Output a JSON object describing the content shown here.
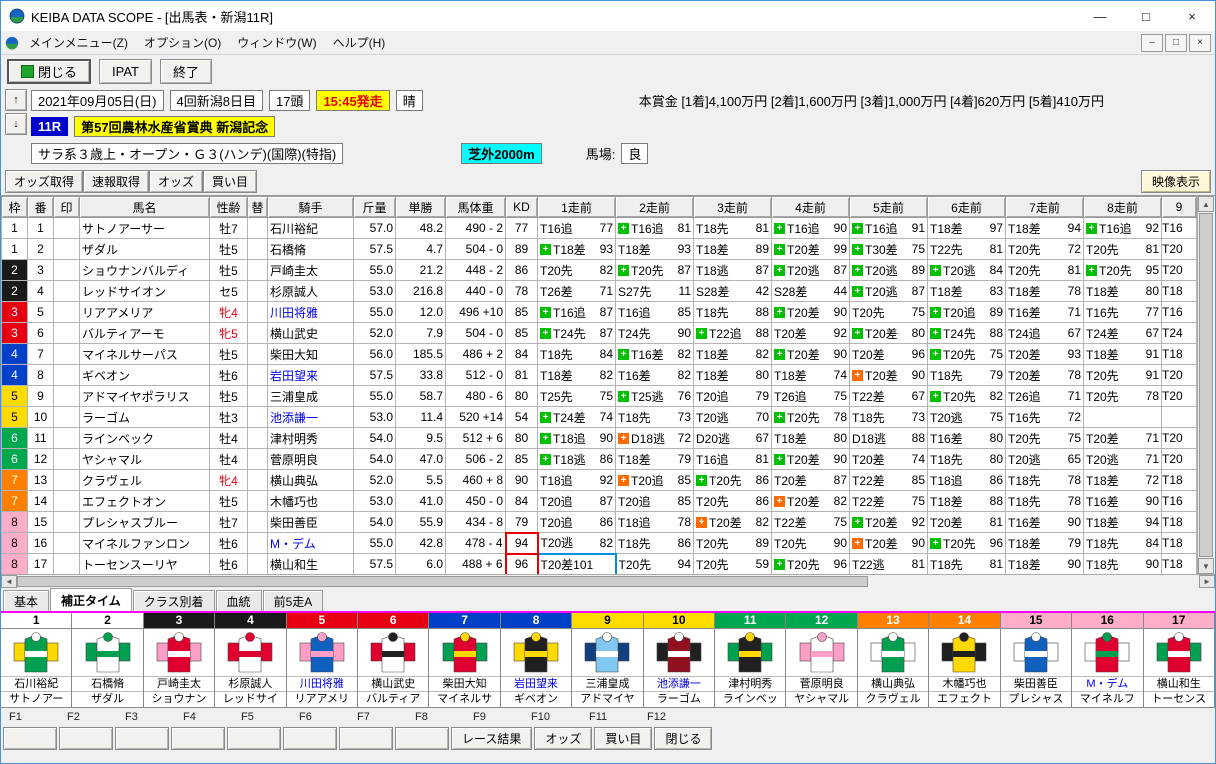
{
  "window": {
    "title": "KEIBA DATA SCOPE - [出馬表・新潟11R]",
    "menu": [
      "メインメニュー(Z)",
      "オプション(O)",
      "ウィンドウ(W)",
      "ヘルプ(H)"
    ]
  },
  "icons": {
    "up": "↑",
    "down": "↓",
    "left": "◄",
    "right": "►",
    "sb_up": "▲",
    "sb_down": "▼",
    "minimize": "—",
    "maximize": "□",
    "close": "×",
    "mdi_minimize": "–",
    "mdi_restore": "□",
    "mdi_close": "×"
  },
  "toolbar": {
    "close": "閉じる",
    "ipat": "IPAT",
    "exit": "終了"
  },
  "race": {
    "date": "2021年09月05日(日)",
    "meeting": "4回新潟8日目",
    "heads": "17頭",
    "start": "15:45発走",
    "weather": "晴",
    "prize": "本賞金 [1着]4,100万円 [2着]1,600万円 [3着]1,000万円 [4着]620万円 [5着]410万円",
    "race_no": "11R",
    "race_name": "第57回農林水産省賞典 新潟記念",
    "conditions": "サラ系３歳上・オープン・Ｇ３(ハンデ)(国際)(特指)",
    "course": "芝外2000m",
    "track_label": "馬場:",
    "track_cond": "良"
  },
  "toolbar2": {
    "buttons": [
      "オッズ取得",
      "速報取得",
      "オッズ",
      "買い目"
    ],
    "right": "映像表示"
  },
  "table": {
    "headers": [
      "枠",
      "番",
      "印",
      "馬名",
      "性齢",
      "替",
      "騎手",
      "斤量",
      "単勝",
      "馬体重",
      "KD",
      "1走前",
      "2走前",
      "3走前",
      "4走前",
      "5走前",
      "6走前",
      "7走前",
      "8走前",
      "9"
    ],
    "rows": [
      {
        "waku": "1",
        "num": "1",
        "mark": "",
        "name": "サトノアーサー",
        "sex": "牡7",
        "sexRed": false,
        "kae": "",
        "jockey": "石川裕紀",
        "jBlue": false,
        "kin": "57.0",
        "odds": "48.2",
        "body": "490 - 2",
        "kd": "77",
        "kdBox": false,
        "races": [
          [
            "",
            "T16追 77"
          ],
          [
            "g",
            "T16追 81"
          ],
          [
            "",
            "T18先 81"
          ],
          [
            "g",
            "T16追 90"
          ],
          [
            "g",
            "T16追 91"
          ],
          [
            "",
            "T18差 97"
          ],
          [
            "",
            "T18差 94"
          ],
          [
            "g",
            "T16追 92"
          ]
        ],
        "cut": "T16"
      },
      {
        "waku": "1",
        "num": "2",
        "mark": "",
        "name": "ザダル",
        "sex": "牡5",
        "kae": "",
        "jockey": "石橋脩",
        "kin": "57.5",
        "odds": "4.7",
        "body": "504 - 0",
        "kd": "89",
        "races": [
          [
            "g",
            "T18差 93"
          ],
          [
            "",
            "T18差 93"
          ],
          [
            "",
            "T18差 89"
          ],
          [
            "g",
            "T20差 99"
          ],
          [
            "g",
            "T30差 75"
          ],
          [
            "",
            "T22先 81"
          ],
          [
            "",
            "T20先 72"
          ],
          [
            "",
            "T20先 81"
          ]
        ],
        "cut": "T20"
      },
      {
        "waku": "2",
        "num": "3",
        "mark": "",
        "name": "ショウナンバルディ",
        "sex": "牡5",
        "kae": "",
        "jockey": "戸崎圭太",
        "kin": "55.0",
        "odds": "21.2",
        "body": "448 - 2",
        "kd": "86",
        "races": [
          [
            "",
            "T20先 82"
          ],
          [
            "g",
            "T20先 87"
          ],
          [
            "",
            "T18逃 87"
          ],
          [
            "g",
            "T20逃 87"
          ],
          [
            "g",
            "T20逃 89"
          ],
          [
            "g",
            "T20逃 84"
          ],
          [
            "",
            "T20先 81"
          ],
          [
            "g",
            "T20先 95"
          ]
        ],
        "cut": "T20"
      },
      {
        "waku": "2",
        "num": "4",
        "mark": "",
        "name": "レッドサイオン",
        "sex": "セ5",
        "kae": "",
        "jockey": "杉原誠人",
        "kin": "53.0",
        "odds": "216.8",
        "body": "440 - 0",
        "kd": "78",
        "races": [
          [
            "",
            "T26差 71"
          ],
          [
            "",
            "S27先 11"
          ],
          [
            "",
            "S28差 42"
          ],
          [
            "",
            "S28差 44"
          ],
          [
            "g",
            "T20逃 87"
          ],
          [
            "",
            "T18差 83"
          ],
          [
            "",
            "T18差 78"
          ],
          [
            "",
            "T18差 80"
          ]
        ],
        "cut": "T18"
      },
      {
        "waku": "3",
        "num": "5",
        "mark": "",
        "name": "リアアメリア",
        "sex": "牝4",
        "sexRed": true,
        "kae": "",
        "jockey": "川田将雅",
        "jBlue": true,
        "kin": "55.0",
        "odds": "12.0",
        "body": "496 +10",
        "kd": "85",
        "races": [
          [
            "g",
            "T16追 87"
          ],
          [
            "",
            "T16追 85"
          ],
          [
            "",
            "T18先 88"
          ],
          [
            "g",
            "T20差 90"
          ],
          [
            "",
            "T20先 75"
          ],
          [
            "g",
            "T20追 89"
          ],
          [
            "",
            "T16差 71"
          ],
          [
            "",
            "T16先 77"
          ]
        ],
        "cut": "T16"
      },
      {
        "waku": "3",
        "num": "6",
        "mark": "",
        "name": "バルティアーモ",
        "sex": "牝5",
        "sexRed": true,
        "kae": "",
        "jockey": "横山武史",
        "kin": "52.0",
        "odds": "7.9",
        "body": "504 - 0",
        "kd": "85",
        "races": [
          [
            "g",
            "T24先 87"
          ],
          [
            "",
            "T24先 90"
          ],
          [
            "g",
            "T22追 88"
          ],
          [
            "",
            "T20差 92"
          ],
          [
            "g",
            "T20差 80"
          ],
          [
            "g",
            "T24先 88"
          ],
          [
            "",
            "T24追 67"
          ],
          [
            "",
            "T24差 67"
          ]
        ],
        "cut": "T24"
      },
      {
        "waku": "4",
        "num": "7",
        "mark": "",
        "name": "マイネルサーパス",
        "sex": "牡5",
        "kae": "",
        "jockey": "柴田大知",
        "kin": "56.0",
        "odds": "185.5",
        "body": "486 + 2",
        "kd": "84",
        "races": [
          [
            "",
            "T18先 84"
          ],
          [
            "g",
            "T16差 82"
          ],
          [
            "",
            "T18差 82"
          ],
          [
            "g",
            "T20差 90"
          ],
          [
            "",
            "T20差 96"
          ],
          [
            "g",
            "T20先 75"
          ],
          [
            "",
            "T20差 93"
          ],
          [
            "",
            "T18差 91"
          ]
        ],
        "cut": "T18"
      },
      {
        "waku": "4",
        "num": "8",
        "mark": "",
        "name": "ギベオン",
        "sex": "牡6",
        "kae": "",
        "jockey": "岩田望来",
        "jBlue": true,
        "kin": "57.5",
        "odds": "33.8",
        "body": "512 - 0",
        "kd": "81",
        "races": [
          [
            "",
            "T18差 82"
          ],
          [
            "",
            "T16差 82"
          ],
          [
            "",
            "T18差 80"
          ],
          [
            "",
            "T18差 74"
          ],
          [
            "o",
            "T20差 90"
          ],
          [
            "",
            "T18先 79"
          ],
          [
            "",
            "T20差 78"
          ],
          [
            "",
            "T20先 91"
          ]
        ],
        "cut": "T20"
      },
      {
        "waku": "5",
        "num": "9",
        "mark": "",
        "name": "アドマイヤポラリス",
        "sex": "牡5",
        "kae": "",
        "jockey": "三浦皇成",
        "kin": "55.0",
        "odds": "58.7",
        "body": "480 - 6",
        "kd": "80",
        "races": [
          [
            "",
            "T25先 75"
          ],
          [
            "g",
            "T25逃 76"
          ],
          [
            "",
            "T20追 79"
          ],
          [
            "",
            "T26追 75"
          ],
          [
            "",
            "T22差 67"
          ],
          [
            "g",
            "T20先 82"
          ],
          [
            "",
            "T26追 71"
          ],
          [
            "",
            "T20先 78"
          ]
        ],
        "cut": "T20"
      },
      {
        "waku": "5",
        "num": "10",
        "mark": "",
        "name": "ラーゴム",
        "sex": "牡3",
        "kae": "",
        "jockey": "池添謙一",
        "jBlue": true,
        "kin": "53.0",
        "odds": "11.4",
        "body": "520 +14",
        "kd": "54",
        "races": [
          [
            "g",
            "T24差 74"
          ],
          [
            "",
            "T18先 73"
          ],
          [
            "",
            "T20逃 70"
          ],
          [
            "g",
            "T20先 78"
          ],
          [
            "",
            "T18先 73"
          ],
          [
            "",
            "T20逃 75"
          ],
          [
            "",
            "T16先 72"
          ],
          [
            "",
            ""
          ]
        ],
        "cut": ""
      },
      {
        "waku": "6",
        "num": "11",
        "mark": "",
        "name": "ラインベック",
        "sex": "牡4",
        "kae": "",
        "jockey": "津村明秀",
        "kin": "54.0",
        "odds": "9.5",
        "body": "512 + 6",
        "kd": "80",
        "races": [
          [
            "g",
            "T18追 90"
          ],
          [
            "o",
            "D18逃 72"
          ],
          [
            "",
            "D20逃 67"
          ],
          [
            "",
            "T18差 80"
          ],
          [
            "",
            "D18逃 88"
          ],
          [
            "",
            "T16差 80"
          ],
          [
            "",
            "T20先 75"
          ],
          [
            "",
            "T20差 71"
          ]
        ],
        "cut": "T20"
      },
      {
        "waku": "6",
        "num": "12",
        "mark": "",
        "name": "ヤシャマル",
        "sex": "牡4",
        "kae": "",
        "jockey": "菅原明良",
        "kin": "54.0",
        "odds": "47.0",
        "body": "506 - 2",
        "kd": "85",
        "races": [
          [
            "g",
            "T18逃 86"
          ],
          [
            "",
            "T18差 79"
          ],
          [
            "",
            "T16追 81"
          ],
          [
            "g",
            "T20差 90"
          ],
          [
            "",
            "T20差 74"
          ],
          [
            "",
            "T18先 80"
          ],
          [
            "",
            "T20逃 65"
          ],
          [
            "",
            "T20逃 71"
          ]
        ],
        "cut": "T20"
      },
      {
        "waku": "7",
        "num": "13",
        "mark": "",
        "name": "クラヴェル",
        "sex": "牝4",
        "sexRed": true,
        "kae": "",
        "jockey": "横山典弘",
        "kin": "52.0",
        "odds": "5.5",
        "body": "460 + 8",
        "kd": "90",
        "races": [
          [
            "",
            "T18追 92"
          ],
          [
            "o",
            "T20追 85"
          ],
          [
            "g",
            "T20先 86"
          ],
          [
            "",
            "T20差 87"
          ],
          [
            "",
            "T22差 85"
          ],
          [
            "",
            "T18追 86"
          ],
          [
            "",
            "T18先 78"
          ],
          [
            "",
            "T18差 72"
          ]
        ],
        "cut": "T18"
      },
      {
        "waku": "7",
        "num": "14",
        "mark": "",
        "name": "エフェクトオン",
        "sex": "牡5",
        "kae": "",
        "jockey": "木幡巧也",
        "kin": "53.0",
        "odds": "41.0",
        "body": "450 - 0",
        "kd": "84",
        "races": [
          [
            "",
            "T20追 87"
          ],
          [
            "",
            "T20追 85"
          ],
          [
            "",
            "T20先 86"
          ],
          [
            "o",
            "T20差 82"
          ],
          [
            "",
            "T22差 75"
          ],
          [
            "",
            "T18差 88"
          ],
          [
            "",
            "T18先 78"
          ],
          [
            "",
            "T16差 90"
          ]
        ],
        "cut": "T16"
      },
      {
        "waku": "8",
        "num": "15",
        "mark": "",
        "name": "プレシャスブルー",
        "sex": "牡7",
        "kae": "",
        "jockey": "柴田善臣",
        "kin": "54.0",
        "odds": "55.9",
        "body": "434 - 8",
        "kd": "79",
        "races": [
          [
            "",
            "T20追 86"
          ],
          [
            "",
            "T18追 78"
          ],
          [
            "o",
            "T20差 82"
          ],
          [
            "",
            "T22差 75"
          ],
          [
            "g",
            "T20差 92"
          ],
          [
            "",
            "T20差 81"
          ],
          [
            "",
            "T16差 90"
          ],
          [
            "",
            "T18差 94"
          ]
        ],
        "cut": "T18"
      },
      {
        "waku": "8",
        "num": "16",
        "mark": "",
        "name": "マイネルファンロン",
        "sex": "牡6",
        "kae": "",
        "jockey": "M・デム",
        "jBlue": true,
        "kin": "55.0",
        "odds": "42.8",
        "body": "478 - 4",
        "kd": "94",
        "kdBox": true,
        "races": [
          [
            "",
            "T20逃 82"
          ],
          [
            "",
            "T18先 86"
          ],
          [
            "",
            "T20先 89"
          ],
          [
            "",
            "T20先 90"
          ],
          [
            "o",
            "T20差 90"
          ],
          [
            "g",
            "T20先 96"
          ],
          [
            "",
            "T18差 79"
          ],
          [
            "",
            "T18先 84"
          ]
        ],
        "cut": "T18"
      },
      {
        "waku": "8",
        "num": "17",
        "mark": "",
        "name": "トーセンスーリヤ",
        "sex": "牡6",
        "kae": "",
        "jockey": "横山和生",
        "kin": "57.5",
        "odds": "6.0",
        "body": "488 + 6",
        "kd": "96",
        "kdBox": true,
        "races": [
          [
            "",
            "T20差101",
            "blue"
          ],
          [
            "",
            "T20先 94"
          ],
          [
            "",
            "T20先 59"
          ],
          [
            "g",
            "T20先 96"
          ],
          [
            "",
            "T22逃 81"
          ],
          [
            "",
            "T18先 81"
          ],
          [
            "",
            "T18差 90"
          ],
          [
            "",
            "T18先 90"
          ]
        ],
        "cut": "T18"
      }
    ]
  },
  "tabs": [
    "基本",
    "補正タイム",
    "クラス別着",
    "血統",
    "前5走A"
  ],
  "active_tab": "補正タイム",
  "silks": [
    {
      "num": "1",
      "waku": "1",
      "jockey": "石川裕紀",
      "jBlue": false,
      "horse": "サトノアー",
      "body": "#00a050",
      "sleeve": "#ffd800",
      "accent": "#ffffff"
    },
    {
      "num": "2",
      "waku": "1",
      "jockey": "石橋脩",
      "jBlue": false,
      "horse": "ザダル",
      "body": "#ffffff",
      "sleeve": "#00a050",
      "accent": "#00a050"
    },
    {
      "num": "3",
      "waku": "2",
      "jockey": "戸崎圭太",
      "jBlue": false,
      "horse": "ショウナン",
      "body": "#e00030",
      "sleeve": "#ff9ec6",
      "accent": "#ffffff"
    },
    {
      "num": "4",
      "waku": "2",
      "jockey": "杉原誠人",
      "jBlue": false,
      "horse": "レッドサイ",
      "body": "#ffffff",
      "sleeve": "#e00030",
      "accent": "#e00030"
    },
    {
      "num": "5",
      "waku": "3",
      "jockey": "川田将雅",
      "jBlue": true,
      "horse": "リアアメリ",
      "body": "#1060c0",
      "sleeve": "#ff9ec6",
      "accent": "#ff9ec6"
    },
    {
      "num": "6",
      "waku": "3",
      "jockey": "横山武史",
      "jBlue": false,
      "horse": "バルティア",
      "body": "#ffffff",
      "sleeve": "#e00030",
      "accent": "#202020"
    },
    {
      "num": "7",
      "waku": "4",
      "jockey": "柴田大知",
      "jBlue": false,
      "horse": "マイネルサ",
      "body": "#e00030",
      "sleeve": "#00a050",
      "accent": "#ffd800"
    },
    {
      "num": "8",
      "waku": "4",
      "jockey": "岩田望来",
      "jBlue": true,
      "horse": "ギベオン",
      "body": "#202020",
      "sleeve": "#ffd800",
      "accent": "#ffd800"
    },
    {
      "num": "9",
      "waku": "5",
      "jockey": "三浦皇成",
      "jBlue": false,
      "horse": "アドマイヤ",
      "body": "#80c8f0",
      "sleeve": "#104080",
      "accent": "#ffffff"
    },
    {
      "num": "10",
      "waku": "5",
      "jockey": "池添謙一",
      "jBlue": true,
      "horse": "ラーゴム",
      "body": "#901020",
      "sleeve": "#202020",
      "accent": "#ffffff"
    },
    {
      "num": "11",
      "waku": "6",
      "jockey": "津村明秀",
      "jBlue": false,
      "horse": "ラインベッ",
      "body": "#202020",
      "sleeve": "#00a050",
      "accent": "#ffd800"
    },
    {
      "num": "12",
      "waku": "6",
      "jockey": "菅原明良",
      "jBlue": false,
      "horse": "ヤシャマル",
      "body": "#ffffff",
      "sleeve": "#ff9ec6",
      "accent": "#ff9ec6"
    },
    {
      "num": "13",
      "waku": "7",
      "jockey": "横山典弘",
      "jBlue": false,
      "horse": "クラヴェル",
      "body": "#00a050",
      "sleeve": "#ffffff",
      "accent": "#ffffff"
    },
    {
      "num": "14",
      "waku": "7",
      "jockey": "木幡巧也",
      "jBlue": false,
      "horse": "エフェクト",
      "body": "#ffd800",
      "sleeve": "#202020",
      "accent": "#202020"
    },
    {
      "num": "15",
      "waku": "8",
      "jockey": "柴田善臣",
      "jBlue": false,
      "horse": "プレシャス",
      "body": "#1060c0",
      "sleeve": "#ffffff",
      "accent": "#ffffff"
    },
    {
      "num": "16",
      "waku": "8",
      "jockey": "M・デム",
      "jBlue": true,
      "horse": "マイネルフ",
      "body": "#e00030",
      "sleeve": "#ffffff",
      "accent": "#00a050"
    },
    {
      "num": "17",
      "waku": "8",
      "jockey": "横山和生",
      "jBlue": false,
      "horse": "トーセンス",
      "body": "#e00030",
      "sleeve": "#00a050",
      "accent": "#ffffff"
    }
  ],
  "fkeys": {
    "labels": [
      "F1",
      "F2",
      "F3",
      "F4",
      "F5",
      "F6",
      "F7",
      "F8",
      "F9",
      "F10",
      "F11",
      "F12"
    ],
    "buttons": [
      "",
      "",
      "",
      "",
      "",
      "",
      "",
      "",
      "レース結果",
      "オッズ",
      "買い目",
      "閉じる"
    ]
  }
}
